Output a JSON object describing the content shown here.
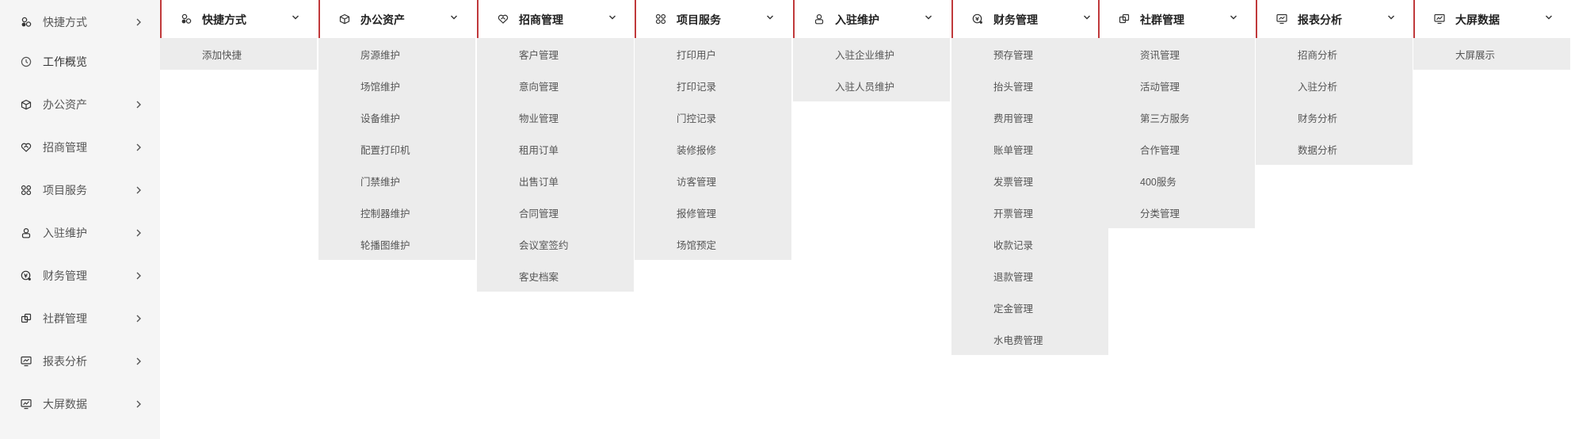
{
  "sidebar": {
    "items": [
      {
        "label": "快捷方式",
        "icon": "shortcut-icon",
        "has_chevron": true
      },
      {
        "label": "工作概览",
        "icon": "clock-icon",
        "has_chevron": false
      },
      {
        "label": "办公资产",
        "icon": "box-icon",
        "has_chevron": true
      },
      {
        "label": "招商管理",
        "icon": "handshake-icon",
        "has_chevron": true
      },
      {
        "label": "项目服务",
        "icon": "grid-icon",
        "has_chevron": true
      },
      {
        "label": "入驻维护",
        "icon": "user-lock-icon",
        "has_chevron": true
      },
      {
        "label": "财务管理",
        "icon": "finance-icon",
        "has_chevron": true
      },
      {
        "label": "社群管理",
        "icon": "community-icon",
        "has_chevron": true
      },
      {
        "label": "报表分析",
        "icon": "monitor-chart-icon",
        "has_chevron": true
      },
      {
        "label": "大屏数据",
        "icon": "screen-data-icon",
        "has_chevron": true
      }
    ]
  },
  "menu": {
    "columns": [
      {
        "title": "快捷方式",
        "icon": "shortcut-icon",
        "items": [
          "添加快捷"
        ]
      },
      {
        "title": "办公资产",
        "icon": "box-icon",
        "items": [
          "房源维护",
          "场馆维护",
          "设备维护",
          "配置打印机",
          "门禁维护",
          "控制器维护",
          "轮播图维护"
        ]
      },
      {
        "title": "招商管理",
        "icon": "handshake-icon",
        "items": [
          "客户管理",
          "意向管理",
          "物业管理",
          "租用订单",
          "出售订单",
          "合同管理",
          "会议室签约",
          "客史档案"
        ]
      },
      {
        "title": "项目服务",
        "icon": "grid-icon",
        "items": [
          "打印用户",
          "打印记录",
          "门控记录",
          "装修报修",
          "访客管理",
          "报修管理",
          "场馆预定"
        ]
      },
      {
        "title": "入驻维护",
        "icon": "user-lock-icon",
        "items": [
          "入驻企业维护",
          "入驻人员维护"
        ]
      },
      {
        "title": "财务管理",
        "icon": "finance-icon",
        "items": [
          "预存管理",
          "抬头管理",
          "费用管理",
          "账单管理",
          "发票管理",
          "开票管理",
          "收款记录",
          "退款管理",
          "定金管理",
          "水电费管理"
        ]
      },
      {
        "title": "社群管理",
        "icon": "community-icon",
        "items": [
          "资讯管理",
          "活动管理",
          "第三方服务",
          "合作管理",
          "400服务",
          "分类管理"
        ]
      },
      {
        "title": "报表分析",
        "icon": "monitor-chart-icon",
        "items": [
          "招商分析",
          "入驻分析",
          "财务分析",
          "数据分析"
        ]
      },
      {
        "title": "大屏数据",
        "icon": "screen-data-icon",
        "items": [
          "大屏展示"
        ]
      }
    ]
  },
  "colors": {
    "accent": "#c0393b",
    "sidebar_bg": "#f5f5f5",
    "dropdown_bg": "#ececec"
  }
}
